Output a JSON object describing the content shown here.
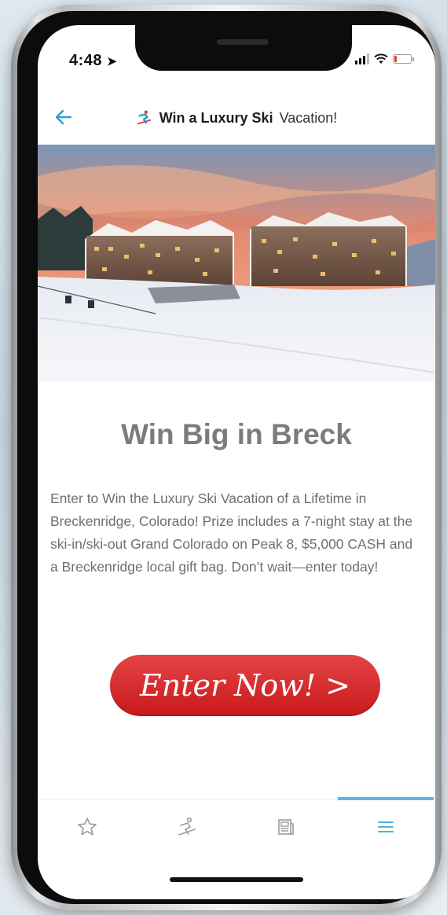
{
  "status_bar": {
    "time": "4:48",
    "battery_level": 0.15,
    "colors": {
      "battery_low": "#e53935"
    }
  },
  "header": {
    "title_prefix": "Win a Luxury Ski",
    "title_suffix": "Vacation!",
    "back_icon": "back-arrow-icon",
    "title_icon": "skier-icon"
  },
  "hero": {
    "icon": "resort-photo"
  },
  "content": {
    "headline": "Win Big in Breck",
    "body": "Enter to Win the Luxury Ski Vacation of a Lifetime in Breckenridge, Colorado! Prize includes a 7-night stay at the ski-in/ski-out Grand Colorado on Peak 8, $5,000 CASH and a Breckenridge local gift bag. Don’t wait—enter today!",
    "cta_label": "Enter Now! >"
  },
  "tabbar": {
    "items": [
      {
        "icon": "star-icon",
        "active": false
      },
      {
        "icon": "skier-tab-icon",
        "active": false
      },
      {
        "icon": "news-icon",
        "active": false
      },
      {
        "icon": "menu-icon",
        "active": true
      }
    ]
  },
  "colors": {
    "accent": "#2a9fd8",
    "tab_active": "#56b7e4",
    "cta": "#d42a2d",
    "headline": "#7c7c7c",
    "body": "#6f6f6f"
  }
}
